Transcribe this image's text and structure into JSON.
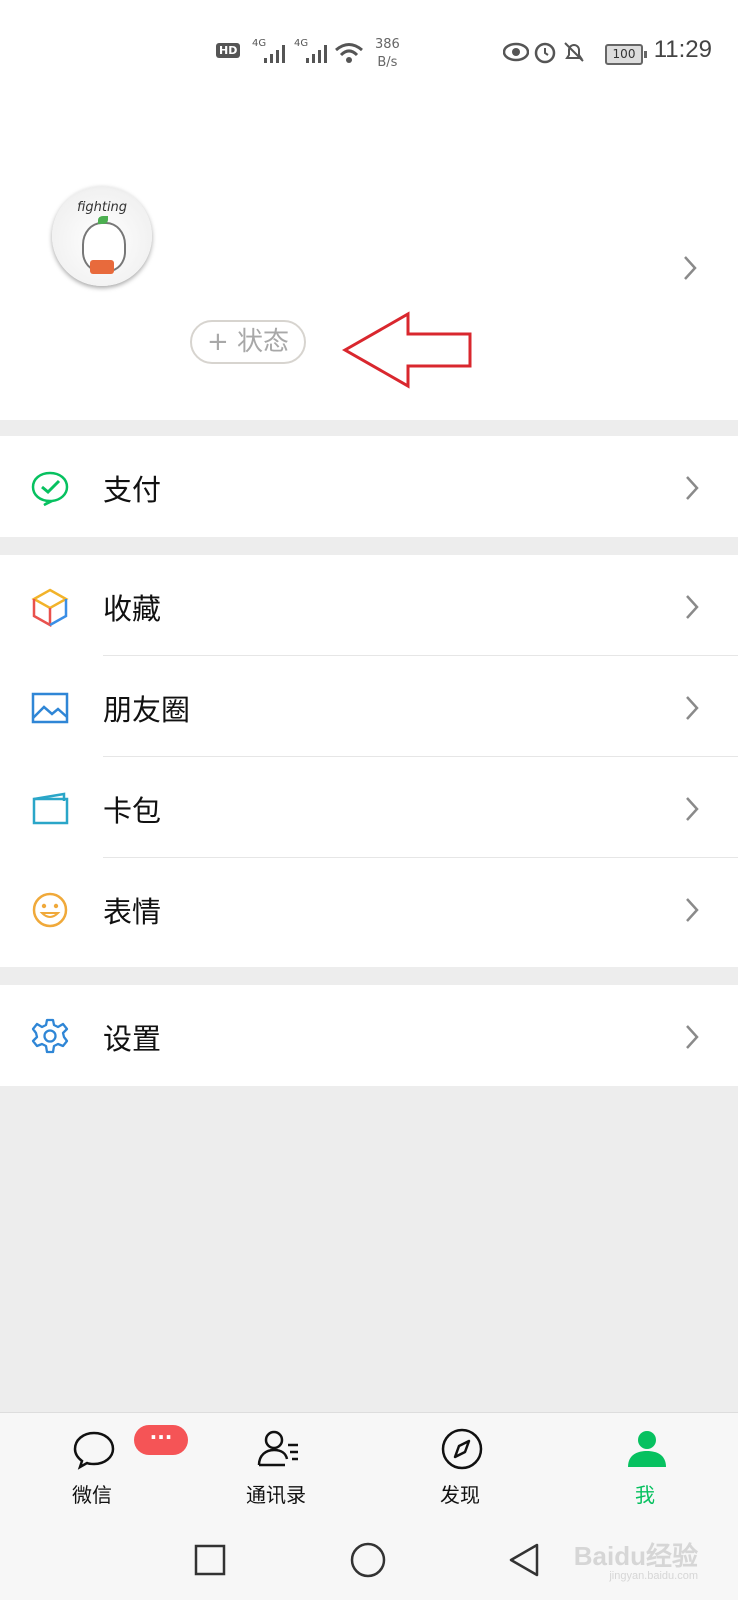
{
  "status_bar": {
    "hd": "HD",
    "signal1": "4G",
    "signal2": "4G",
    "speed_value": "386",
    "speed_unit": "B/s",
    "battery": "100",
    "time": "11:29"
  },
  "profile": {
    "avatar_text": "fighting",
    "status_button": "+ 状态"
  },
  "menu": {
    "pay": "支付",
    "favorites": "收藏",
    "moments": "朋友圈",
    "cards": "卡包",
    "stickers": "表情",
    "settings": "设置"
  },
  "tabs": {
    "chats": "微信",
    "chats_badge": "···",
    "contacts": "通讯录",
    "discover": "发现",
    "me": "我"
  },
  "watermark": {
    "brand": "Baidu经验",
    "url": "jingyan.baidu.com"
  },
  "colors": {
    "accent_green": "#07c160",
    "badge_red": "#f55456",
    "annotation_red": "#d9272e"
  }
}
